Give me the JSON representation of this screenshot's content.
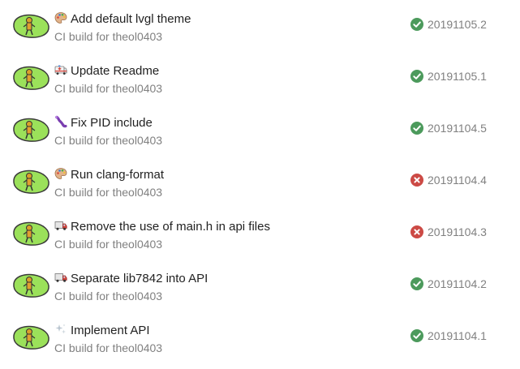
{
  "builds": [
    {
      "emoji": "artist-palette-icon",
      "title": "Add default lvgl theme",
      "subtitle": "CI build for theol0403",
      "status": "success",
      "version": "20191105.2"
    },
    {
      "emoji": "ambulance-icon",
      "title": "Update Readme",
      "subtitle": "CI build for theol0403",
      "status": "success",
      "version": "20191105.1"
    },
    {
      "emoji": "bug-icon",
      "title": "Fix PID include",
      "subtitle": "CI build for theol0403",
      "status": "success",
      "version": "20191104.5"
    },
    {
      "emoji": "artist-palette-icon",
      "title": "Run clang-format",
      "subtitle": "CI build for theol0403",
      "status": "failed",
      "version": "20191104.4"
    },
    {
      "emoji": "truck-icon",
      "title": "Remove the use of main.h in api files",
      "subtitle": "CI build for theol0403",
      "status": "failed",
      "version": "20191104.3"
    },
    {
      "emoji": "truck-icon",
      "title": "Separate lib7842 into API",
      "subtitle": "CI build for theol0403",
      "status": "success",
      "version": "20191104.2"
    },
    {
      "emoji": "sparkles-icon",
      "title": "Implement API",
      "subtitle": "CI build for theol0403",
      "status": "success",
      "version": "20191104.1"
    }
  ],
  "colors": {
    "success": "#4c9a5c",
    "failed": "#cc4a45",
    "title": "#222222",
    "muted": "#808080",
    "avatar_green": "#9be15a"
  }
}
